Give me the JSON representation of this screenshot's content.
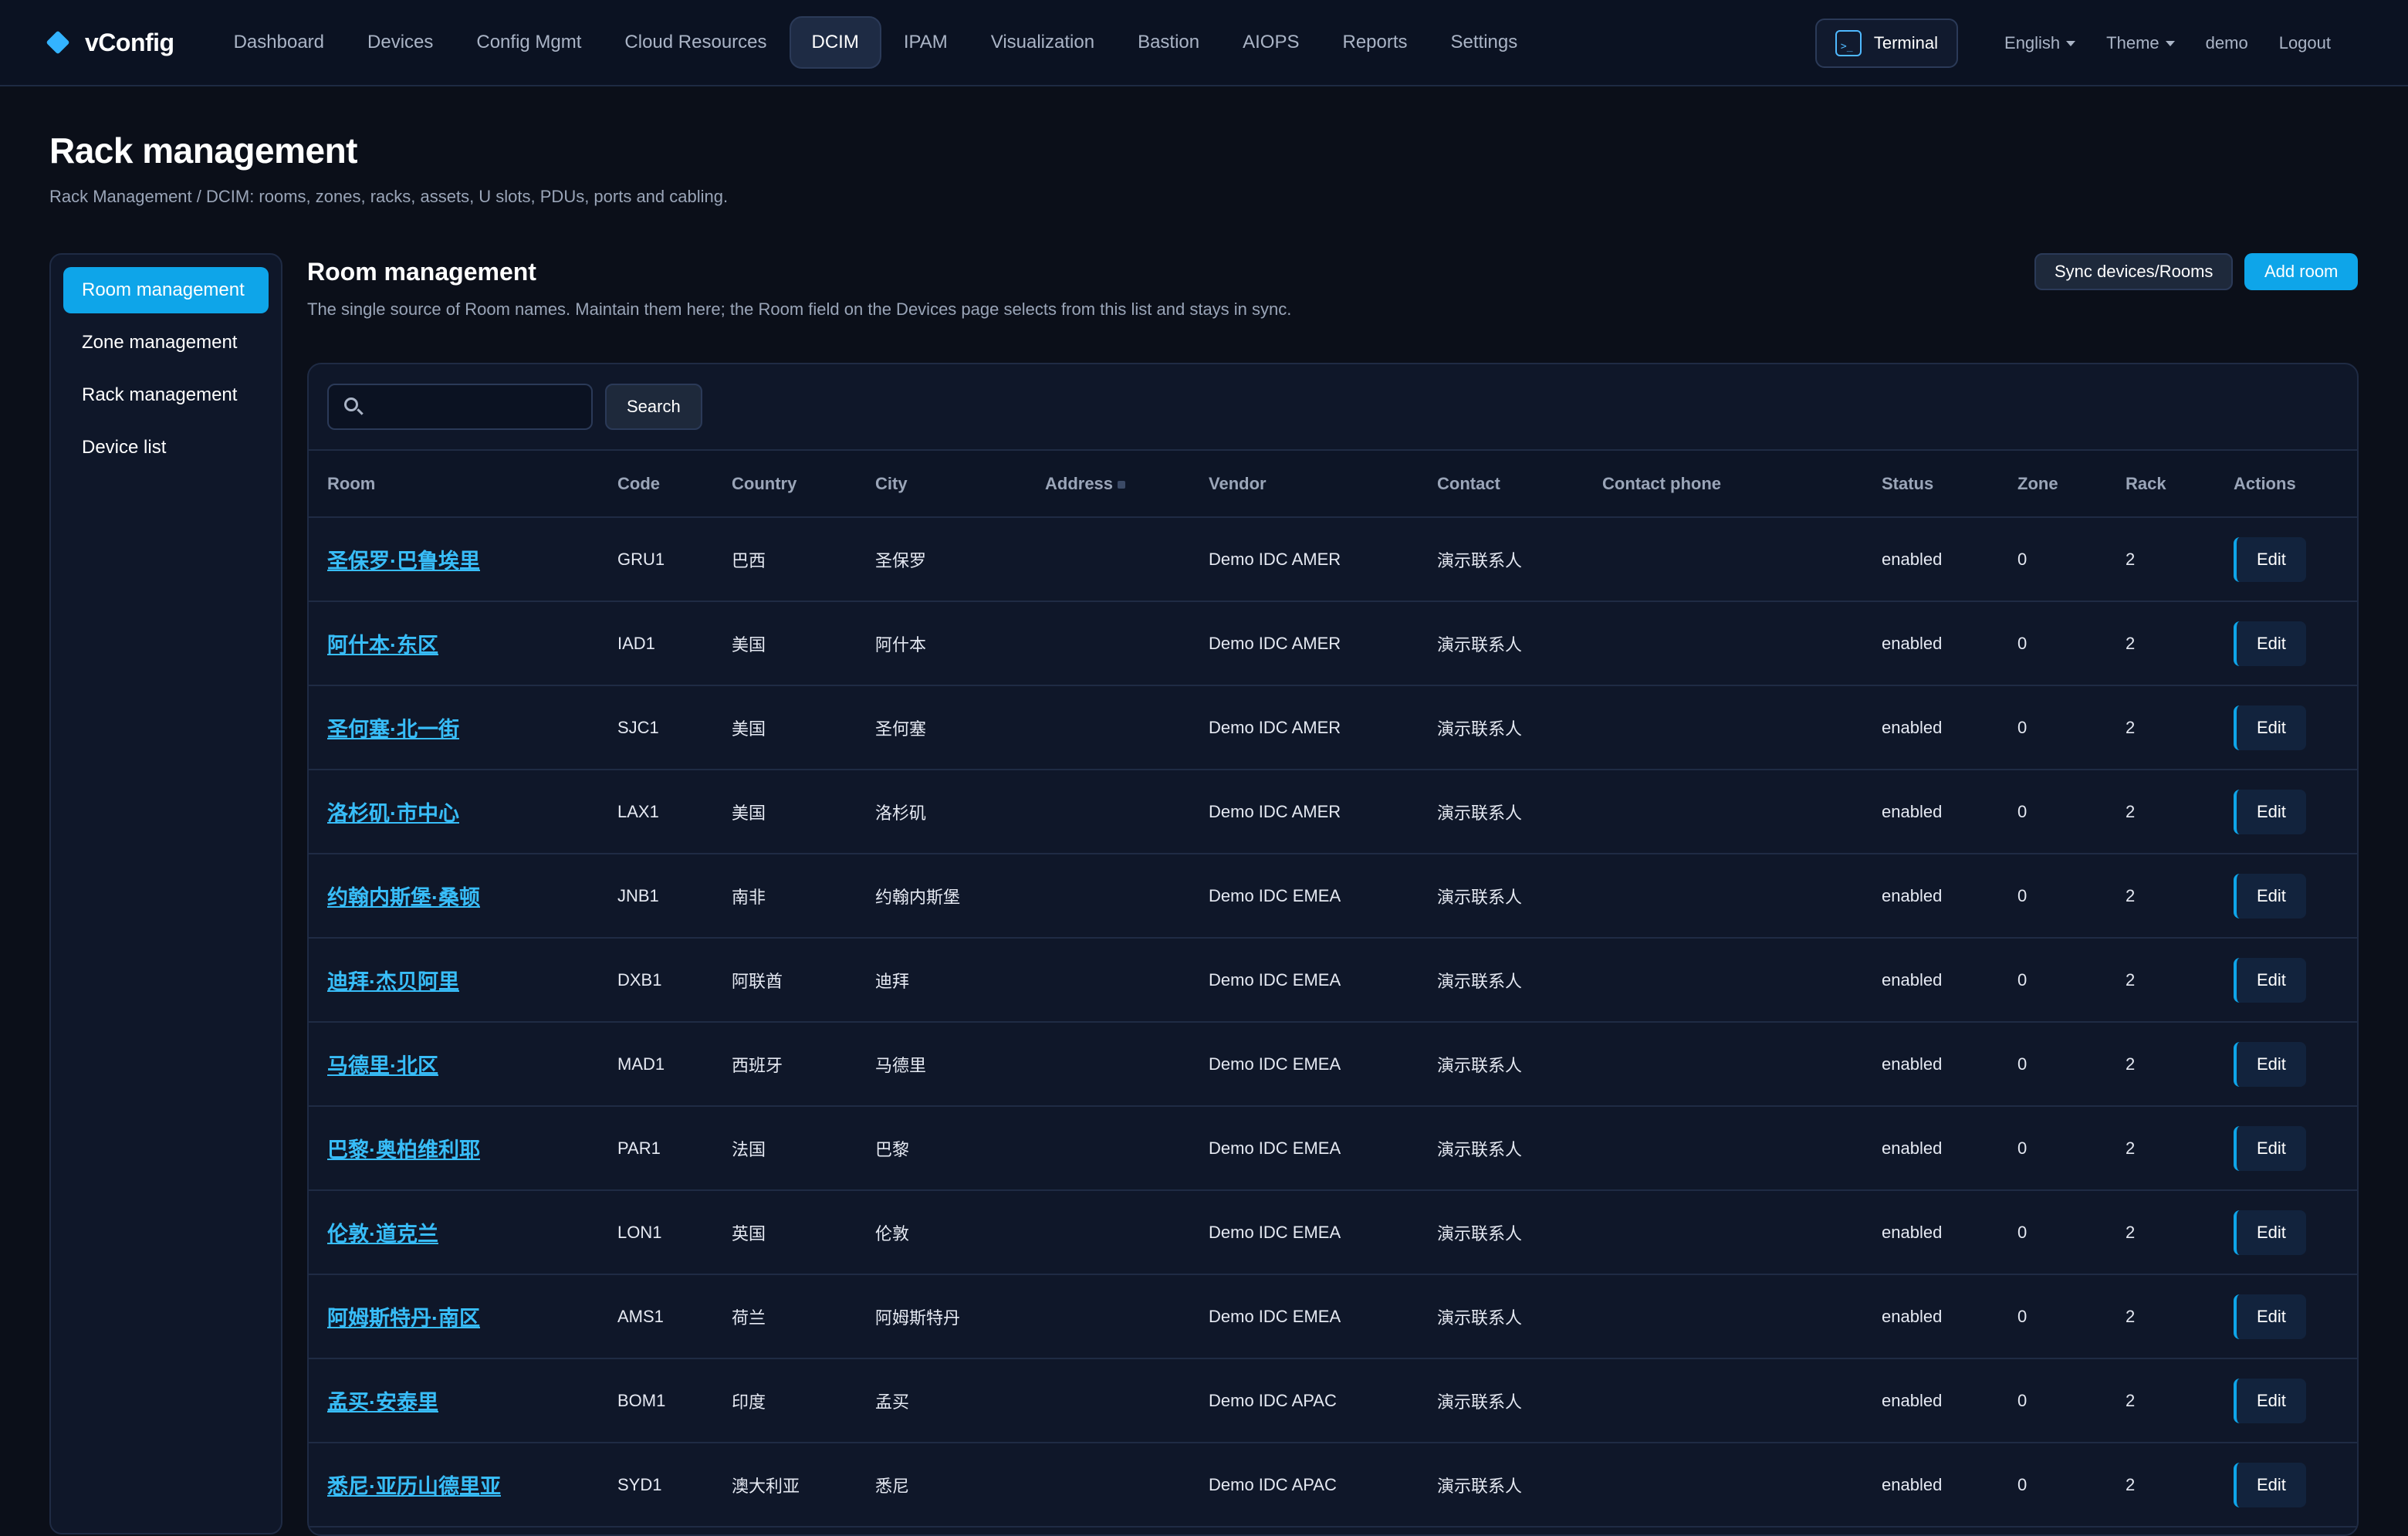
{
  "app": {
    "name": "vConfig"
  },
  "nav": {
    "items": [
      {
        "label": "Dashboard"
      },
      {
        "label": "Devices"
      },
      {
        "label": "Config Mgmt"
      },
      {
        "label": "Cloud Resources"
      },
      {
        "label": "DCIM"
      },
      {
        "label": "IPAM"
      },
      {
        "label": "Visualization"
      },
      {
        "label": "Bastion"
      },
      {
        "label": "AIOPS"
      },
      {
        "label": "Reports"
      },
      {
        "label": "Settings"
      }
    ],
    "active": "DCIM",
    "terminal_label": "Terminal",
    "language_label": "English",
    "theme_label": "Theme",
    "user_label": "demo",
    "logout_label": "Logout"
  },
  "page": {
    "title": "Rack management",
    "subtitle": "Rack Management / DCIM: rooms, zones, racks, assets, U slots, PDUs, ports and cabling."
  },
  "sidebar": {
    "items": [
      {
        "label": "Room management"
      },
      {
        "label": "Zone management"
      },
      {
        "label": "Rack management"
      },
      {
        "label": "Device list"
      }
    ],
    "active": "Room management"
  },
  "section": {
    "title": "Room management",
    "description": "The single source of Room names. Maintain them here; the Room field on the Devices page selects from this list and stays in sync.",
    "sync_label": "Sync devices/Rooms",
    "add_label": "Add room"
  },
  "search": {
    "value": "",
    "placeholder": "",
    "button_label": "Search"
  },
  "table": {
    "columns": [
      "Room",
      "Code",
      "Country",
      "City",
      "Address",
      "Vendor",
      "Contact",
      "Contact phone",
      "Status",
      "Zone",
      "Rack",
      "Actions"
    ],
    "edit_label": "Edit",
    "rows": [
      {
        "room": "圣保罗·巴鲁埃里",
        "code": "GRU1",
        "country": "巴西",
        "city": "圣保罗",
        "address": "",
        "vendor": "Demo IDC AMER",
        "contact": "演示联系人",
        "phone": "",
        "status": "enabled",
        "zone": "0",
        "rack": "2"
      },
      {
        "room": "阿什本·东区",
        "code": "IAD1",
        "country": "美国",
        "city": "阿什本",
        "address": "",
        "vendor": "Demo IDC AMER",
        "contact": "演示联系人",
        "phone": "",
        "status": "enabled",
        "zone": "0",
        "rack": "2"
      },
      {
        "room": "圣何塞·北一街",
        "code": "SJC1",
        "country": "美国",
        "city": "圣何塞",
        "address": "",
        "vendor": "Demo IDC AMER",
        "contact": "演示联系人",
        "phone": "",
        "status": "enabled",
        "zone": "0",
        "rack": "2"
      },
      {
        "room": "洛杉矶·市中心",
        "code": "LAX1",
        "country": "美国",
        "city": "洛杉矶",
        "address": "",
        "vendor": "Demo IDC AMER",
        "contact": "演示联系人",
        "phone": "",
        "status": "enabled",
        "zone": "0",
        "rack": "2"
      },
      {
        "room": "约翰内斯堡·桑顿",
        "code": "JNB1",
        "country": "南非",
        "city": "约翰内斯堡",
        "address": "",
        "vendor": "Demo IDC EMEA",
        "contact": "演示联系人",
        "phone": "",
        "status": "enabled",
        "zone": "0",
        "rack": "2"
      },
      {
        "room": "迪拜·杰贝阿里",
        "code": "DXB1",
        "country": "阿联酋",
        "city": "迪拜",
        "address": "",
        "vendor": "Demo IDC EMEA",
        "contact": "演示联系人",
        "phone": "",
        "status": "enabled",
        "zone": "0",
        "rack": "2"
      },
      {
        "room": "马德里·北区",
        "code": "MAD1",
        "country": "西班牙",
        "city": "马德里",
        "address": "",
        "vendor": "Demo IDC EMEA",
        "contact": "演示联系人",
        "phone": "",
        "status": "enabled",
        "zone": "0",
        "rack": "2"
      },
      {
        "room": "巴黎·奥柏维利耶",
        "code": "PAR1",
        "country": "法国",
        "city": "巴黎",
        "address": "",
        "vendor": "Demo IDC EMEA",
        "contact": "演示联系人",
        "phone": "",
        "status": "enabled",
        "zone": "0",
        "rack": "2"
      },
      {
        "room": "伦敦·道克兰",
        "code": "LON1",
        "country": "英国",
        "city": "伦敦",
        "address": "",
        "vendor": "Demo IDC EMEA",
        "contact": "演示联系人",
        "phone": "",
        "status": "enabled",
        "zone": "0",
        "rack": "2"
      },
      {
        "room": "阿姆斯特丹·南区",
        "code": "AMS1",
        "country": "荷兰",
        "city": "阿姆斯特丹",
        "address": "",
        "vendor": "Demo IDC EMEA",
        "contact": "演示联系人",
        "phone": "",
        "status": "enabled",
        "zone": "0",
        "rack": "2"
      },
      {
        "room": "孟买·安泰里",
        "code": "BOM1",
        "country": "印度",
        "city": "孟买",
        "address": "",
        "vendor": "Demo IDC APAC",
        "contact": "演示联系人",
        "phone": "",
        "status": "enabled",
        "zone": "0",
        "rack": "2"
      },
      {
        "room": "悉尼·亚历山德里亚",
        "code": "SYD1",
        "country": "澳大利亚",
        "city": "悉尼",
        "address": "",
        "vendor": "Demo IDC APAC",
        "contact": "演示联系人",
        "phone": "",
        "status": "enabled",
        "zone": "0",
        "rack": "2"
      }
    ]
  },
  "colors": {
    "background": "#0b0f19",
    "accent": "#0ea5e9",
    "link": "#38bdf8"
  }
}
